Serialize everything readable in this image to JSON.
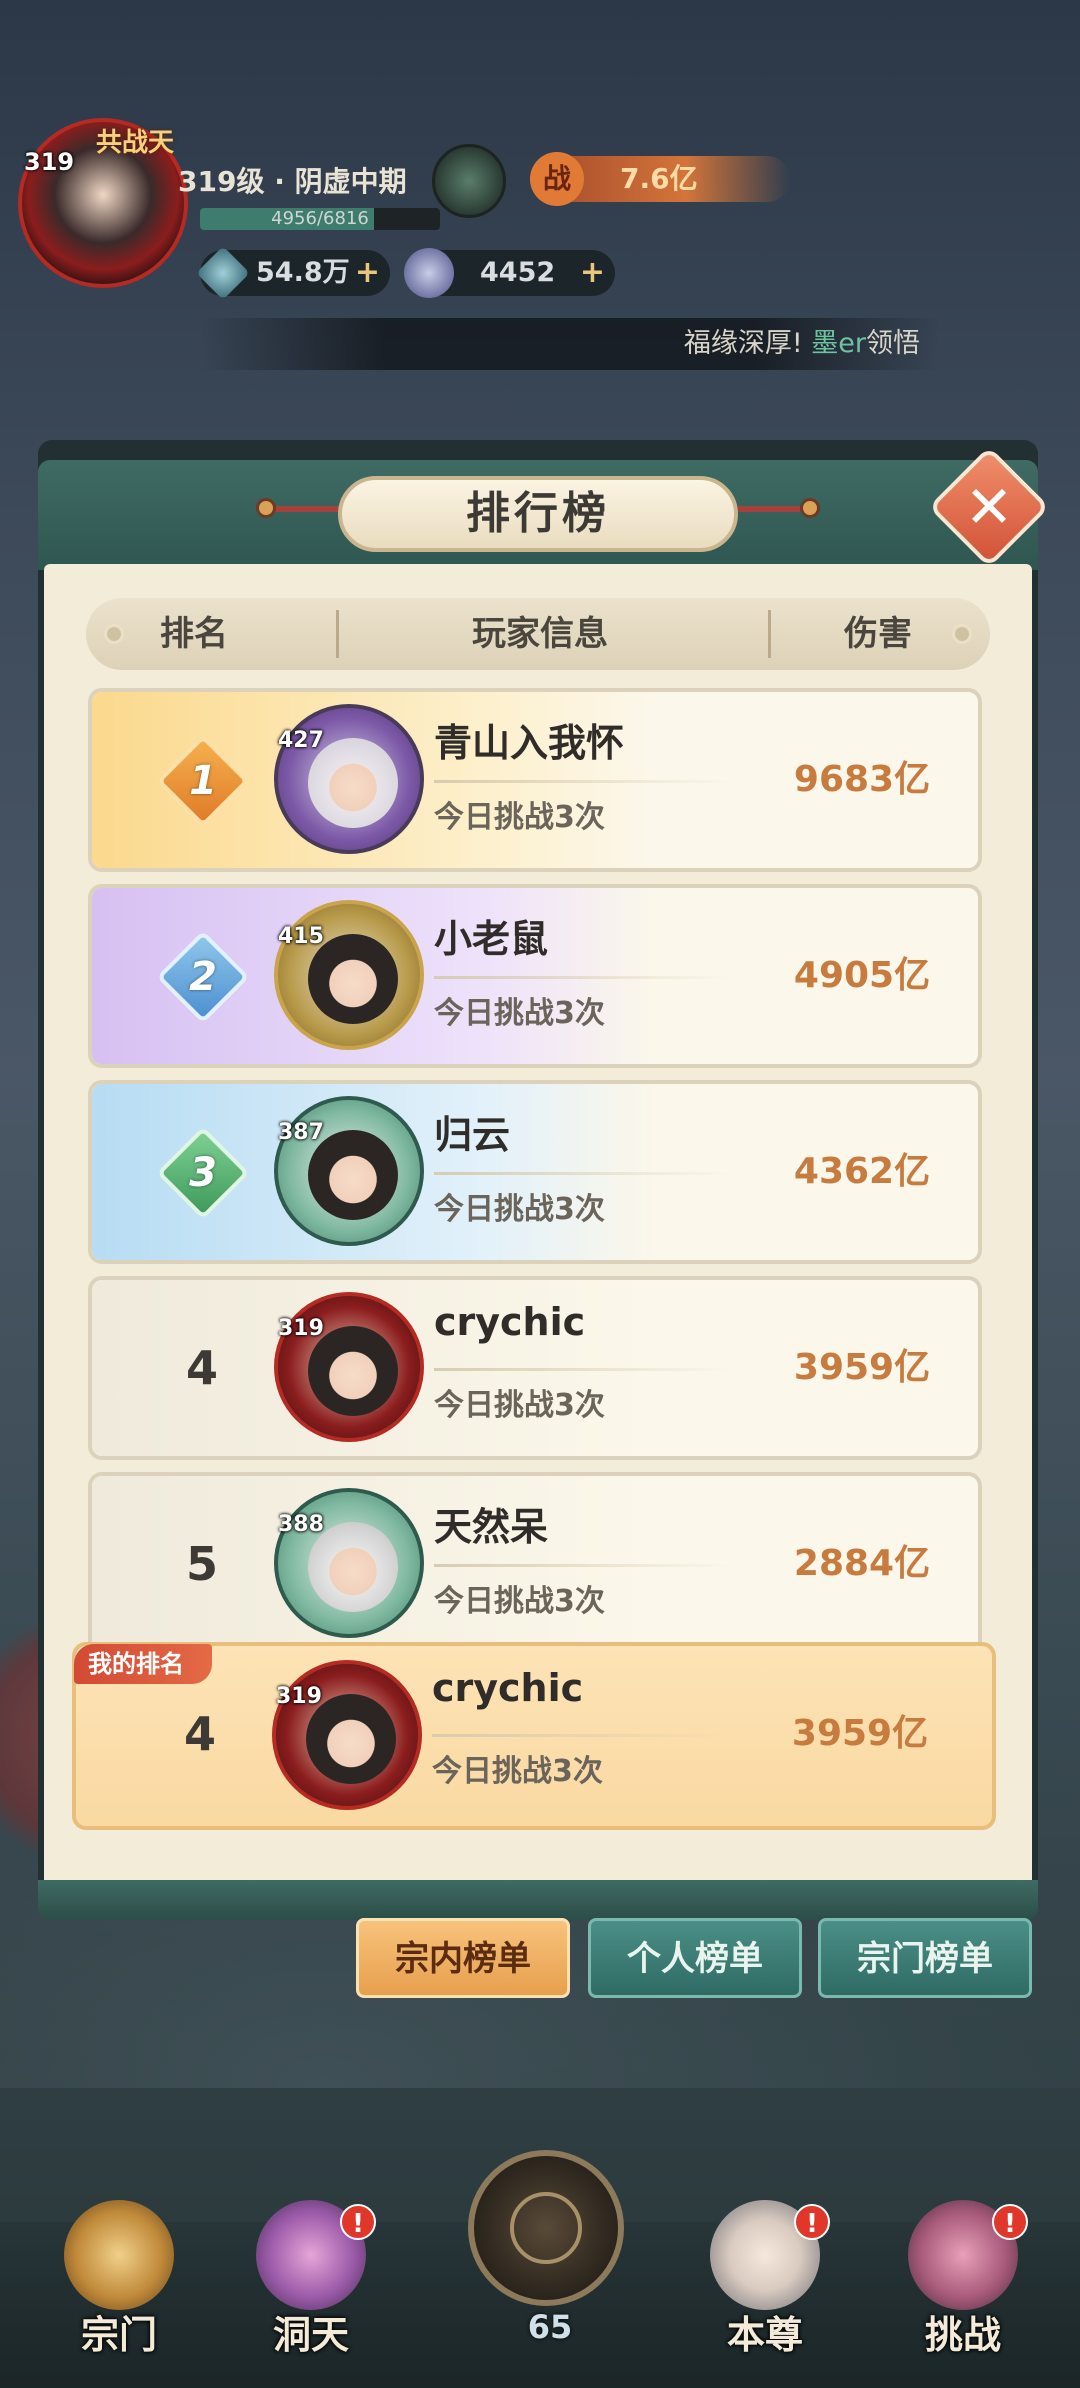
{
  "hud": {
    "level": "319",
    "avatar_title": "共战天",
    "realm": "319级 · 阴虚中期",
    "exp_text": "4956/6816",
    "exp_ratio": 0.727,
    "power_icon": "战",
    "power": "7.6亿",
    "jade": "54.8万",
    "coin": "4452",
    "plus": "+",
    "ticker_prefix": "福缘深厚!",
    "ticker_name": "墨er",
    "ticker_suffix": "领悟",
    "colors": {
      "accent": "#c87b3e",
      "panel": "#3f6b64",
      "my_row": "#fde3b6"
    }
  },
  "panel": {
    "title": "排行榜",
    "close_icon": "close-icon",
    "columns": {
      "rank": "排名",
      "player": "玩家信息",
      "damage": "伤害"
    }
  },
  "rows": [
    {
      "rank": "1",
      "level": "427",
      "name": "青山入我怀",
      "sub": "今日挑战3次",
      "damage": "9683亿"
    },
    {
      "rank": "2",
      "level": "415",
      "name": "小老鼠",
      "sub": "今日挑战3次",
      "damage": "4905亿"
    },
    {
      "rank": "3",
      "level": "387",
      "name": "归云",
      "sub": "今日挑战3次",
      "damage": "4362亿"
    },
    {
      "rank": "4",
      "level": "319",
      "name": "crychic",
      "sub": "今日挑战3次",
      "damage": "3959亿"
    },
    {
      "rank": "5",
      "level": "388",
      "name": "天然呆",
      "sub": "今日挑战3次",
      "damage": "2884亿"
    }
  ],
  "my_rank": {
    "tag": "我的排名",
    "rank": "4",
    "level": "319",
    "name": "crychic",
    "sub": "今日挑战3次",
    "damage": "3959亿"
  },
  "tabs": [
    {
      "label": "宗内榜单",
      "active": true
    },
    {
      "label": "个人榜单",
      "active": false
    },
    {
      "label": "宗门榜单",
      "active": false
    }
  ],
  "nav": {
    "sect": "宗门",
    "cave": "洞天",
    "center_count": "65",
    "self": "本尊",
    "challenge": "挑战",
    "badge": "!"
  }
}
